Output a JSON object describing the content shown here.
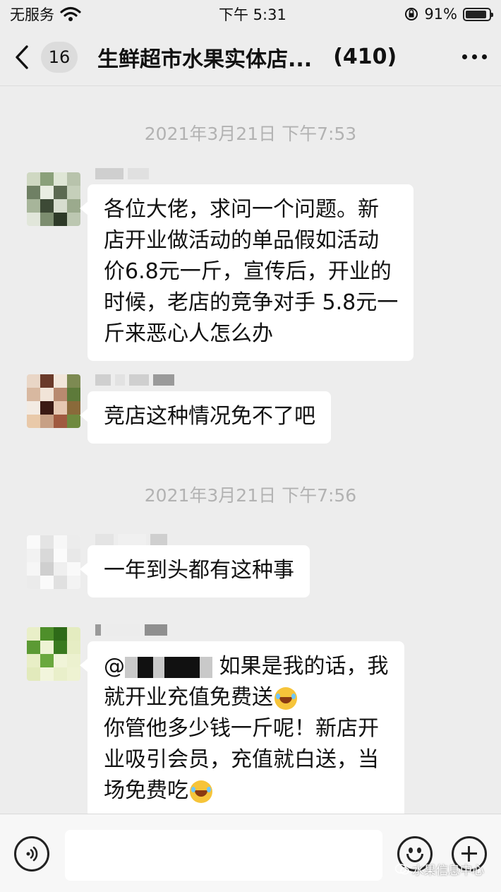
{
  "status_bar": {
    "carrier": "无服务",
    "time": "下午 5:31",
    "battery": "91%",
    "battery_level": 0.91
  },
  "nav": {
    "unread_count": "16",
    "title": "生鲜超市水果实体店...",
    "member_count": "(410)"
  },
  "messages": {
    "timestamp_1": "2021年3月21日 下午7:53",
    "msg1_lines": [
      "各位大佬，求问一个问题。新",
      "店开业做活动的单品假如活动",
      "价6.8元一斤，宣传后，开业的",
      "时候，老店的竞争对手 5.8元一",
      "斤来恶心人怎么办"
    ],
    "msg2": "竞店这种情况免不了吧",
    "timestamp_2": "2021年3月21日 下午7:56",
    "msg3": "一年到头都有这种事",
    "msg4_line1_prefix": "@",
    "msg4_line1_suffix": "如果是我的话，我",
    "msg4_line2": "就开业充值免费送",
    "msg4_line3": "你管他多少钱一斤呢！新店开",
    "msg4_line4": "业吸引会员，充值就白送，当",
    "msg4_line5": "场免费吃"
  },
  "icons": {
    "back": "chevron-left-icon",
    "more": "more-icon",
    "voice": "voice-icon",
    "emoji": "emoji-icon",
    "plus": "plus-icon"
  },
  "watermark": "水果信息中心"
}
